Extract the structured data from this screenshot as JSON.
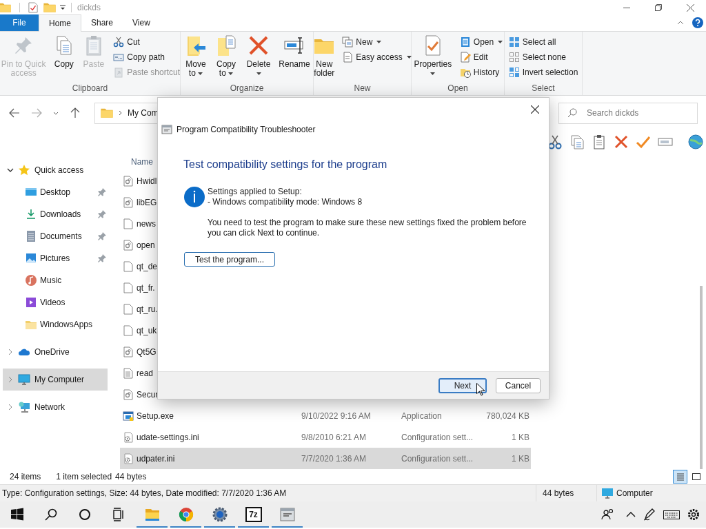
{
  "window": {
    "title": "dickds"
  },
  "ribbon_tabs": [
    {
      "label": "File",
      "kind": "file",
      "selected": false
    },
    {
      "label": "Home",
      "kind": "tab",
      "selected": true
    },
    {
      "label": "Share",
      "kind": "tab",
      "selected": false
    },
    {
      "label": "View",
      "kind": "tab",
      "selected": false
    }
  ],
  "ribbon_groups": [
    {
      "label": "Clipboard",
      "large": [
        {
          "label": "Pin to Quick access",
          "disabled": true,
          "menu": false
        },
        {
          "label": "Copy",
          "disabled": false,
          "menu": false
        },
        {
          "label": "Paste",
          "disabled": true,
          "menu": false
        }
      ],
      "small": [
        {
          "label": "Cut",
          "disabled": false,
          "menu": false
        },
        {
          "label": "Copy path",
          "disabled": false,
          "menu": false
        },
        {
          "label": "Paste shortcut",
          "disabled": true,
          "menu": false
        }
      ]
    },
    {
      "label": "Organize",
      "large": [
        {
          "label": "Move to",
          "disabled": false,
          "menu": true
        },
        {
          "label": "Copy to",
          "disabled": false,
          "menu": true
        },
        {
          "label": "Delete",
          "disabled": false,
          "menu": true
        },
        {
          "label": "Rename",
          "disabled": false,
          "menu": false
        }
      ]
    },
    {
      "label": "New",
      "large": [
        {
          "label": "New folder",
          "disabled": false,
          "menu": false
        }
      ],
      "small": [
        {
          "label": "New",
          "disabled": false,
          "menu": true
        },
        {
          "label": "Easy access",
          "disabled": false,
          "menu": true
        }
      ]
    },
    {
      "label": "Open",
      "large": [
        {
          "label": "Properties",
          "disabled": false,
          "menu": true
        }
      ],
      "small": [
        {
          "label": "Open",
          "disabled": false,
          "menu": true
        },
        {
          "label": "Edit",
          "disabled": false,
          "menu": false
        },
        {
          "label": "History",
          "disabled": false,
          "menu": false
        }
      ]
    },
    {
      "label": "Select",
      "small": [
        {
          "label": "Select all",
          "disabled": false,
          "menu": false
        },
        {
          "label": "Select none",
          "disabled": false,
          "menu": false
        },
        {
          "label": "Invert selection",
          "disabled": false,
          "menu": false
        }
      ]
    }
  ],
  "address": {
    "path": "My Com"
  },
  "search": {
    "placeholder": "Search dickds"
  },
  "nav_tree": [
    {
      "label": "Quick access",
      "expanded": true,
      "selected": false,
      "children": [
        {
          "label": "Desktop",
          "pinned": true,
          "selected": false
        },
        {
          "label": "Downloads",
          "pinned": true,
          "selected": false
        },
        {
          "label": "Documents",
          "pinned": true,
          "selected": false
        },
        {
          "label": "Pictures",
          "pinned": true,
          "selected": false
        },
        {
          "label": "Music",
          "pinned": false,
          "selected": false
        },
        {
          "label": "Videos",
          "pinned": false,
          "selected": false
        },
        {
          "label": "WindowsApps",
          "pinned": false,
          "selected": false
        }
      ]
    },
    {
      "label": "OneDrive",
      "expanded": false,
      "selected": false
    },
    {
      "label": "My Computer",
      "expanded": false,
      "selected": true
    },
    {
      "label": "Network",
      "expanded": false,
      "selected": false
    }
  ],
  "file_list": {
    "columns": [
      "Name"
    ],
    "rows": [
      {
        "name": "Hwidl",
        "kind": "library",
        "selected": false
      },
      {
        "name": "libEG",
        "kind": "library",
        "selected": false
      },
      {
        "name": "news",
        "kind": "blank",
        "selected": false
      },
      {
        "name": "open",
        "kind": "library",
        "selected": false
      },
      {
        "name": "qt_de",
        "kind": "blank",
        "selected": false
      },
      {
        "name": "qt_fr.",
        "kind": "blank",
        "selected": false
      },
      {
        "name": "qt_ru.",
        "kind": "blank",
        "selected": false
      },
      {
        "name": "qt_uk",
        "kind": "blank",
        "selected": false
      },
      {
        "name": "Qt5G",
        "kind": "library",
        "selected": false
      },
      {
        "name": "read",
        "kind": "text",
        "selected": false
      },
      {
        "name": "Secur",
        "kind": "library",
        "selected": false
      },
      {
        "name": "Setup.exe",
        "kind": "app",
        "date": "9/10/2022 9:16 AM",
        "type": "Application",
        "size": "780,024 KB",
        "selected": false
      },
      {
        "name": "udate-settings.ini",
        "kind": "config",
        "date": "9/8/2010 6:21 AM",
        "type": "Configuration sett...",
        "size": "1 KB",
        "selected": false
      },
      {
        "name": "udpater.ini",
        "kind": "config",
        "date": "7/7/2020 1:36 AM",
        "type": "Configuration sett...",
        "size": "1 KB",
        "selected": true
      }
    ]
  },
  "status": {
    "count": "24 items",
    "selection": "1 item selected",
    "size": "44 bytes"
  },
  "view_buttons": [
    {
      "selected": true
    },
    {
      "selected": false
    }
  ],
  "details_bar": {
    "text": "Type: Configuration settings, Size: 44 bytes, Date modified: 7/7/2020 1:36 AM",
    "size": "44 bytes",
    "location": "Computer"
  },
  "dialog": {
    "title": "Program Compatibility Troubleshooter",
    "heading": "Test compatibility settings for the program",
    "settings": [
      "Settings applied to Setup:",
      "- Windows compatibility mode: Windows 8"
    ],
    "message": "You need to test the program to make sure these new settings fixed the problem before you can click Next to continue.",
    "test_button": "Test the program...",
    "buttons": [
      {
        "label": "Next",
        "focused": true
      },
      {
        "label": "Cancel",
        "focused": false
      }
    ]
  },
  "taskbar": {
    "archive_label": "7z"
  }
}
